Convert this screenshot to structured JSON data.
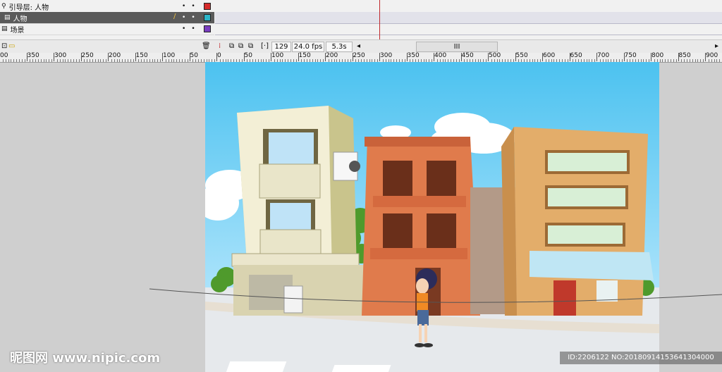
{
  "timeline": {
    "layers": [
      {
        "name": "引导层: 人物",
        "color": "#d62b2b",
        "selected": false
      },
      {
        "name": "人物",
        "color": "#2bb5c8",
        "selected": true
      },
      {
        "name": "场景",
        "color": "#7a3ec0",
        "selected": false
      }
    ],
    "frame_number": "129",
    "frame_rate": "24.0 fps",
    "elapsed": "5.3s",
    "scroll_handle": "III"
  },
  "ruler": {
    "ticks": [
      "00",
      "350",
      "300",
      "250",
      "200",
      "150",
      "100",
      "50",
      "0",
      "50",
      "100",
      "150",
      "200",
      "250",
      "300",
      "350",
      "400",
      "450",
      "500",
      "550",
      "600",
      "650",
      "700",
      "750",
      "800",
      "850",
      "900"
    ]
  },
  "overlay": {
    "site_logo": "昵图网 www.nipic.com",
    "image_id": "ID:2206122 NO:20180914153641304000"
  },
  "colors": {
    "sky_top": "#4cc2f0",
    "sky_bottom": "#cdefff",
    "ground": "#e6e9ec"
  }
}
